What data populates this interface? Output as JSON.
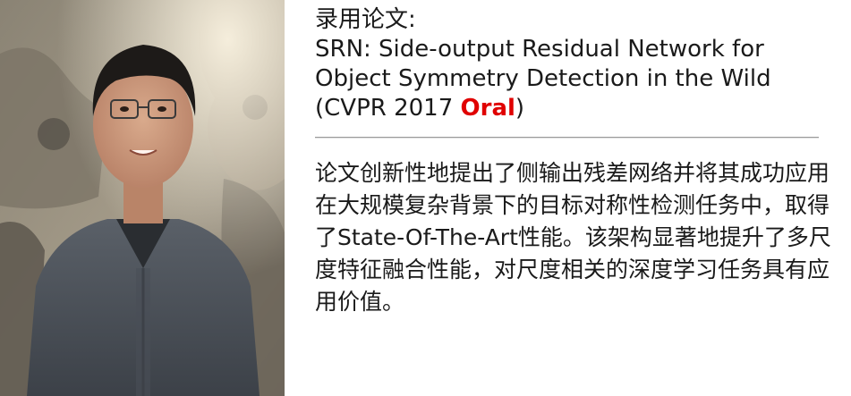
{
  "label": "录用论文:",
  "paper": {
    "title_line1": "SRN: Side-output Residual Network for",
    "title_line2": "Object Symmetry Detection in the Wild",
    "venue_prefix": "(CVPR 2017 ",
    "venue_highlight": "Oral",
    "venue_suffix": ")"
  },
  "description": "论文创新性地提出了侧输出残差网络并将其成功应用在大规模复杂背景下的目标对称性检测任务中，取得了State-Of-The-Art性能。该架构显著地提升了多尺度特征融合性能，对尺度相关的深度学习任务具有应用价值。",
  "colors": {
    "highlight": "#e00000"
  },
  "photo": {
    "icon": "person-portrait"
  }
}
